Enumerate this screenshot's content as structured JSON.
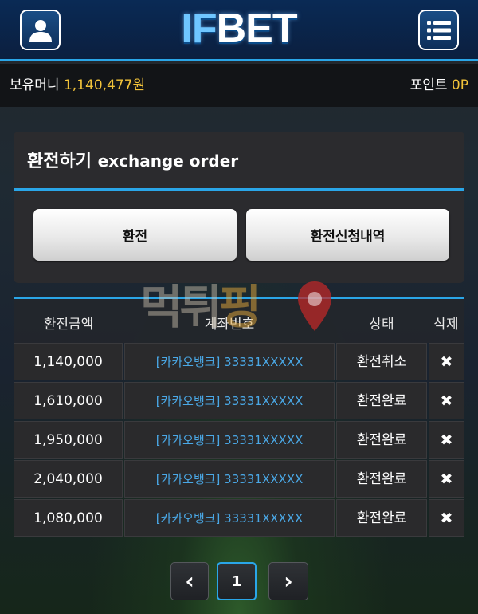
{
  "header": {
    "logo_text_1": "IF",
    "logo_text_2": "BET",
    "user_icon": "user-icon",
    "menu_icon": "list-menu-icon"
  },
  "balance": {
    "money_label": "보유머니",
    "money_value": "1,140,477원",
    "point_label": "포인트",
    "point_value": "0P"
  },
  "exchange": {
    "title": "환전하기",
    "title_en": "exchange order",
    "buttons": [
      "환전",
      "환전신청내역"
    ]
  },
  "table": {
    "headers": [
      "환전금액",
      "계좌번호",
      "상태",
      "삭제"
    ],
    "rows": [
      {
        "amount": "1,140,000",
        "account": "[카카오뱅크] 33331XXXXX",
        "status": "환전취소",
        "delete": "✖"
      },
      {
        "amount": "1,610,000",
        "account": "[카카오뱅크] 33331XXXXX",
        "status": "환전완료",
        "delete": "✖"
      },
      {
        "amount": "1,950,000",
        "account": "[카카오뱅크] 33331XXXXX",
        "status": "환전완료",
        "delete": "✖"
      },
      {
        "amount": "2,040,000",
        "account": "[카카오뱅크] 33331XXXXX",
        "status": "환전완료",
        "delete": "✖"
      },
      {
        "amount": "1,080,000",
        "account": "[카카오뱅크] 33331XXXXX",
        "status": "환전완료",
        "delete": "✖"
      }
    ]
  },
  "pagination": {
    "prev": "‹",
    "current": "1",
    "next": "›"
  },
  "watermark": {
    "text_1": "먹튀",
    "text_2": "핑"
  },
  "colors": {
    "accent": "#2aa6e8",
    "money": "#f2c33a",
    "account_link": "#4aa8e6"
  }
}
